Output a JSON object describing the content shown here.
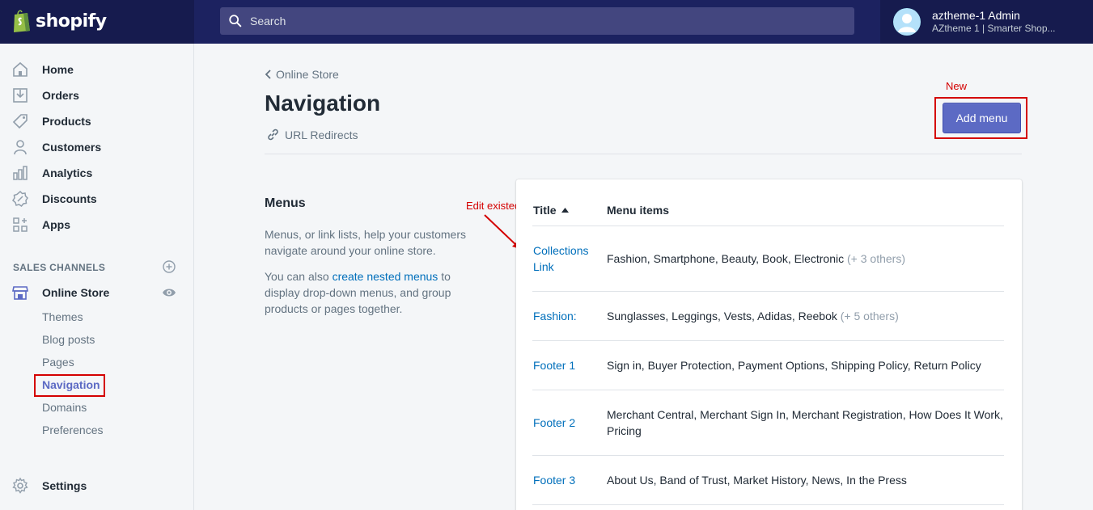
{
  "topbar": {
    "logo_text": "shopify",
    "search_placeholder": "Search",
    "user_name": "aztheme-1 Admin",
    "user_shop": "AZtheme 1 | Smarter Shop..."
  },
  "sidebar": {
    "items": [
      {
        "label": "Home",
        "icon": "home-icon"
      },
      {
        "label": "Orders",
        "icon": "orders-icon"
      },
      {
        "label": "Products",
        "icon": "tag-icon"
      },
      {
        "label": "Customers",
        "icon": "person-icon"
      },
      {
        "label": "Analytics",
        "icon": "bar-chart-icon"
      },
      {
        "label": "Discounts",
        "icon": "discount-icon"
      },
      {
        "label": "Apps",
        "icon": "apps-icon"
      }
    ],
    "sales_channels_title": "SALES CHANNELS",
    "online_store_label": "Online Store",
    "sub_items": [
      "Themes",
      "Blog posts",
      "Pages",
      "Navigation",
      "Domains",
      "Preferences"
    ],
    "active_sub_item": "Navigation",
    "settings_label": "Settings"
  },
  "main": {
    "breadcrumb": "Online Store",
    "title": "Navigation",
    "url_redirects": "URL Redirects",
    "annotation_new": "New",
    "add_menu_label": "Add menu",
    "menus_title": "Menus",
    "menus_desc": "Menus, or link lists, help your customers navigate around your online store.",
    "menus_desc2_prefix": "You can also ",
    "menus_desc2_link": "create nested menus",
    "menus_desc2_suffix": " to display drop-down menus, and group products or pages together.",
    "annotation_edit": "Edit existed"
  },
  "table": {
    "col_title": "Title",
    "col_items": "Menu items",
    "rows": [
      {
        "title": "Collections Link",
        "items": "Fashion, Smartphone, Beauty, Book, Electronic",
        "others": "(+ 3 others)"
      },
      {
        "title": "Fashion:",
        "items": "Sunglasses, Leggings, Vests, Adidas, Reebok",
        "others": "(+ 5 others)"
      },
      {
        "title": "Footer 1",
        "items": "Sign in, Buyer Protection, Payment Options, Shipping Policy, Return Policy",
        "others": ""
      },
      {
        "title": "Footer 2",
        "items": "Merchant Central, Merchant Sign In, Merchant Registration, How Does It Work, Pricing",
        "others": ""
      },
      {
        "title": "Footer 3",
        "items": "About Us, Band of Trust, Market History, News, In the Press",
        "others": ""
      }
    ]
  },
  "colors": {
    "topbar": "#1c2260",
    "accent": "#5c6ac4",
    "link": "#006fbb",
    "annotation": "#d40000"
  }
}
